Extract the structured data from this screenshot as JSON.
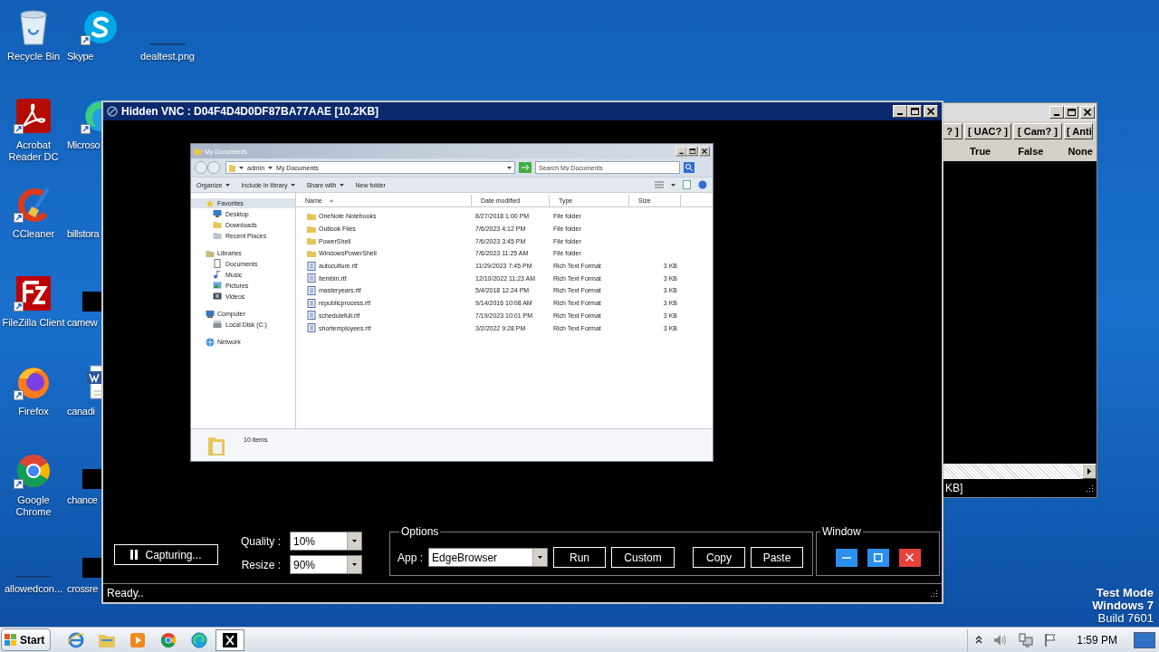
{
  "desktop": {
    "icons": [
      {
        "kind": "recycle_bin",
        "label": "Recycle Bin",
        "shortcut": false
      },
      {
        "kind": "acrobat",
        "label": "Acrobat Reader DC",
        "shortcut": true
      },
      {
        "kind": "ccleaner",
        "label": "CCleaner",
        "shortcut": true
      },
      {
        "kind": "filezilla",
        "label": "FileZilla Client",
        "shortcut": true
      },
      {
        "kind": "firefox",
        "label": "Firefox",
        "shortcut": true
      },
      {
        "kind": "chrome",
        "label": "Google Chrome",
        "shortcut": true
      },
      {
        "kind": "blank",
        "label": "allowedcon...",
        "shortcut": false
      },
      {
        "kind": "skype",
        "label": "Skype",
        "shortcut": true
      },
      {
        "kind": "edge",
        "label": "Microso",
        "shortcut": true
      },
      {
        "kind": "none",
        "label": "billstora",
        "shortcut": false
      },
      {
        "kind": "dark",
        "label": "camew",
        "shortcut": false
      },
      {
        "kind": "word",
        "label": "canadi",
        "shortcut": false
      },
      {
        "kind": "dark",
        "label": "chance",
        "shortcut": false
      },
      {
        "kind": "dark",
        "label": "crossre",
        "shortcut": false
      },
      {
        "kind": "blank",
        "label": "dealtest.png",
        "shortcut": false
      }
    ],
    "os_notice": [
      "Test Mode",
      "Windows 7",
      "Build 7601"
    ]
  },
  "background_window": {
    "tabs": [
      "? ]",
      "[ UAC? ]",
      "[ Cam? ]",
      "[ Anti"
    ],
    "values": [
      "True",
      "False",
      "None"
    ],
    "status": "KB]"
  },
  "vnc_window": {
    "title": "Hidden VNC : D04F4D4D0DF87BA77AAE [10.2KB]",
    "explorer": {
      "title": "My Documents",
      "breadcrumb": [
        "admin",
        "My Documents"
      ],
      "search_placeholder": "Search My Documents",
      "toolbar": [
        {
          "label": "Organize",
          "menu": true
        },
        {
          "label": "Include in library",
          "menu": true
        },
        {
          "label": "Share with",
          "menu": true
        },
        {
          "label": "New folder",
          "menu": false
        }
      ],
      "nav": [
        {
          "label": "Favorites",
          "kind": "favorites",
          "selected": true,
          "children": [
            {
              "label": "Desktop",
              "kind": "desktop",
              "selected": false
            },
            {
              "label": "Downloads",
              "kind": "downloads",
              "selected": false
            },
            {
              "label": "Recent Places",
              "kind": "recent",
              "selected": false
            }
          ]
        },
        {
          "label": "Libraries",
          "kind": "libraries",
          "selected": false,
          "children": [
            {
              "label": "Documents",
              "kind": "documents",
              "selected": false
            },
            {
              "label": "Music",
              "kind": "music",
              "selected": false
            },
            {
              "label": "Pictures",
              "kind": "pictures",
              "selected": false
            },
            {
              "label": "Videos",
              "kind": "videos",
              "selected": false
            }
          ]
        },
        {
          "label": "Computer",
          "kind": "computer",
          "selected": false,
          "children": [
            {
              "label": "Local Disk (C:)",
              "kind": "disk",
              "selected": false
            }
          ]
        },
        {
          "label": "Network",
          "kind": "network",
          "selected": false
        }
      ],
      "columns": [
        "Name",
        "Date modified",
        "Type",
        "Size"
      ],
      "rows": [
        {
          "kind": "folder",
          "name": "OneNote Notebooks",
          "date": "8/27/2018 1:00 PM",
          "type": "File folder"
        },
        {
          "kind": "folder",
          "name": "Outlook Files",
          "date": "7/6/2023 4:12 PM",
          "type": "File folder"
        },
        {
          "kind": "folder",
          "name": "PowerShell",
          "date": "7/6/2023 3:45 PM",
          "type": "File folder"
        },
        {
          "kind": "folder",
          "name": "WindowsPowerShell",
          "date": "7/6/2023 11:25 AM",
          "type": "File folder"
        },
        {
          "kind": "rtf",
          "name": "autoculture.rtf",
          "date": "11/29/2023 7:45 PM",
          "type": "Rich Text Format",
          "size": "3 KB"
        },
        {
          "kind": "rtf",
          "name": "itembin.rtf",
          "date": "12/10/2022 11:23 AM",
          "type": "Rich Text Format",
          "size": "3 KB"
        },
        {
          "kind": "rtf",
          "name": "masteryears.rtf",
          "date": "5/4/2018 12:24 PM",
          "type": "Rich Text Format",
          "size": "3 KB"
        },
        {
          "kind": "rtf",
          "name": "republicprocess.rtf",
          "date": "9/14/2016 10:08 AM",
          "type": "Rich Text Format",
          "size": "3 KB"
        },
        {
          "kind": "rtf",
          "name": "schedulefull.rtf",
          "date": "7/19/2023 10:01 PM",
          "type": "Rich Text Format",
          "size": "3 KB"
        },
        {
          "kind": "rtf",
          "name": "shortemployees.rtf",
          "date": "3/2/2022 9:28 PM",
          "type": "Rich Text Format",
          "size": "3 KB"
        }
      ],
      "status": "10 items"
    },
    "capture_button": "Capturing...",
    "quality": {
      "label": "Quality :",
      "value": "10%"
    },
    "resize": {
      "label": "Resize :",
      "value": "90%"
    },
    "options": {
      "legend": "Options",
      "app_label": "App :",
      "app_value": "EdgeBrowser",
      "buttons": [
        "Run",
        "Custom",
        "Copy",
        "Paste"
      ]
    },
    "window_group": {
      "legend": "Window",
      "buttons": [
        {
          "kind": "minimize"
        },
        {
          "kind": "maximize"
        },
        {
          "kind": "close"
        }
      ]
    },
    "status": "Ready.."
  },
  "taskbar": {
    "start": "Start",
    "apps": [
      {
        "kind": "ie",
        "selected": false
      },
      {
        "kind": "explorer",
        "selected": false
      },
      {
        "kind": "media",
        "selected": false
      },
      {
        "kind": "chrome",
        "selected": false
      },
      {
        "kind": "edge",
        "selected": false
      },
      {
        "kind": "x",
        "selected": true
      }
    ],
    "tray": [
      {
        "kind": "chevron"
      },
      {
        "kind": "speaker"
      },
      {
        "kind": "network"
      },
      {
        "kind": "flag"
      }
    ],
    "time": "1:59 PM"
  }
}
